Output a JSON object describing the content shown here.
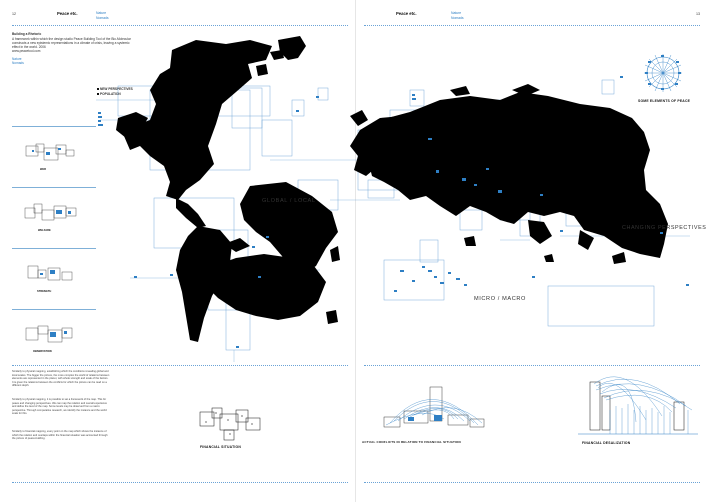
{
  "left_page": {
    "folio": "12",
    "header_title": "Peace etc.",
    "header_sub_1": "Nature",
    "header_sub_2": "Nomads",
    "intro_heading": "Building a Rhetoric",
    "intro_lines": [
      "A framework within which the design studio Peace Building Tool of the Bio-Molecular",
      "constructs a new epistemic representations in a climate of crisis, leaving a systemic",
      "effect in the world. 2006",
      "www.peacetool.com"
    ],
    "intro_links": [
      "Nature",
      "Nomads"
    ],
    "legend_items": [
      "NEW PERSPECTIVES",
      "POPULATION"
    ],
    "thumbs": [
      {
        "label": "WAR"
      },
      {
        "label": "WELFARE"
      },
      {
        "label": "STRENGTH"
      },
      {
        "label": "OBSERVATION"
      }
    ],
    "body_paragraphs": [
      "Similarly to physical mapping, establishing which the conditions revealing global and local scales. The bigger the picture, the more complex the world of relations between elements are represented in the planet, with whole strength and scale of the factors. It is given the relations between the conflicts for which the picture can be read on a different depth.",
      "Similarly to physical mapping, it is possible to set a framework of the map. This for peace and changing perspectives. We can map the relation and overall experience and define the level of the map. Some levels may be observed from a macro perspective. Through comparative research, we identify the instance and the world scale for this.",
      "Similarly to financial mapping, every point on the map which shows the instance of which the relation and overlaps within the financial situation was accounted through the picture of peace-building."
    ],
    "caption": "FINANCIAL SITUATION"
  },
  "right_page": {
    "folio": "13",
    "header_title": "Peace etc.",
    "header_sub_1": "Nature",
    "header_sub_2": "Nomads",
    "icon_caption": "SOME ELEMENTS OF PEACE",
    "captions": [
      "ACTUAL CONFLICTS IN RELATION TO FINANCIAL SITUATION",
      "FINANCIAL DESALIZATION"
    ]
  },
  "map_labels": {
    "global_local": "GLOBAL / LOCAL",
    "micro_macro": "MICRO / MACRO",
    "changing": "CHANGING PERSPECTIVES"
  },
  "colors": {
    "accent": "#2e7fc4",
    "landmass": "#000000",
    "rule": "#7fb0d8"
  }
}
